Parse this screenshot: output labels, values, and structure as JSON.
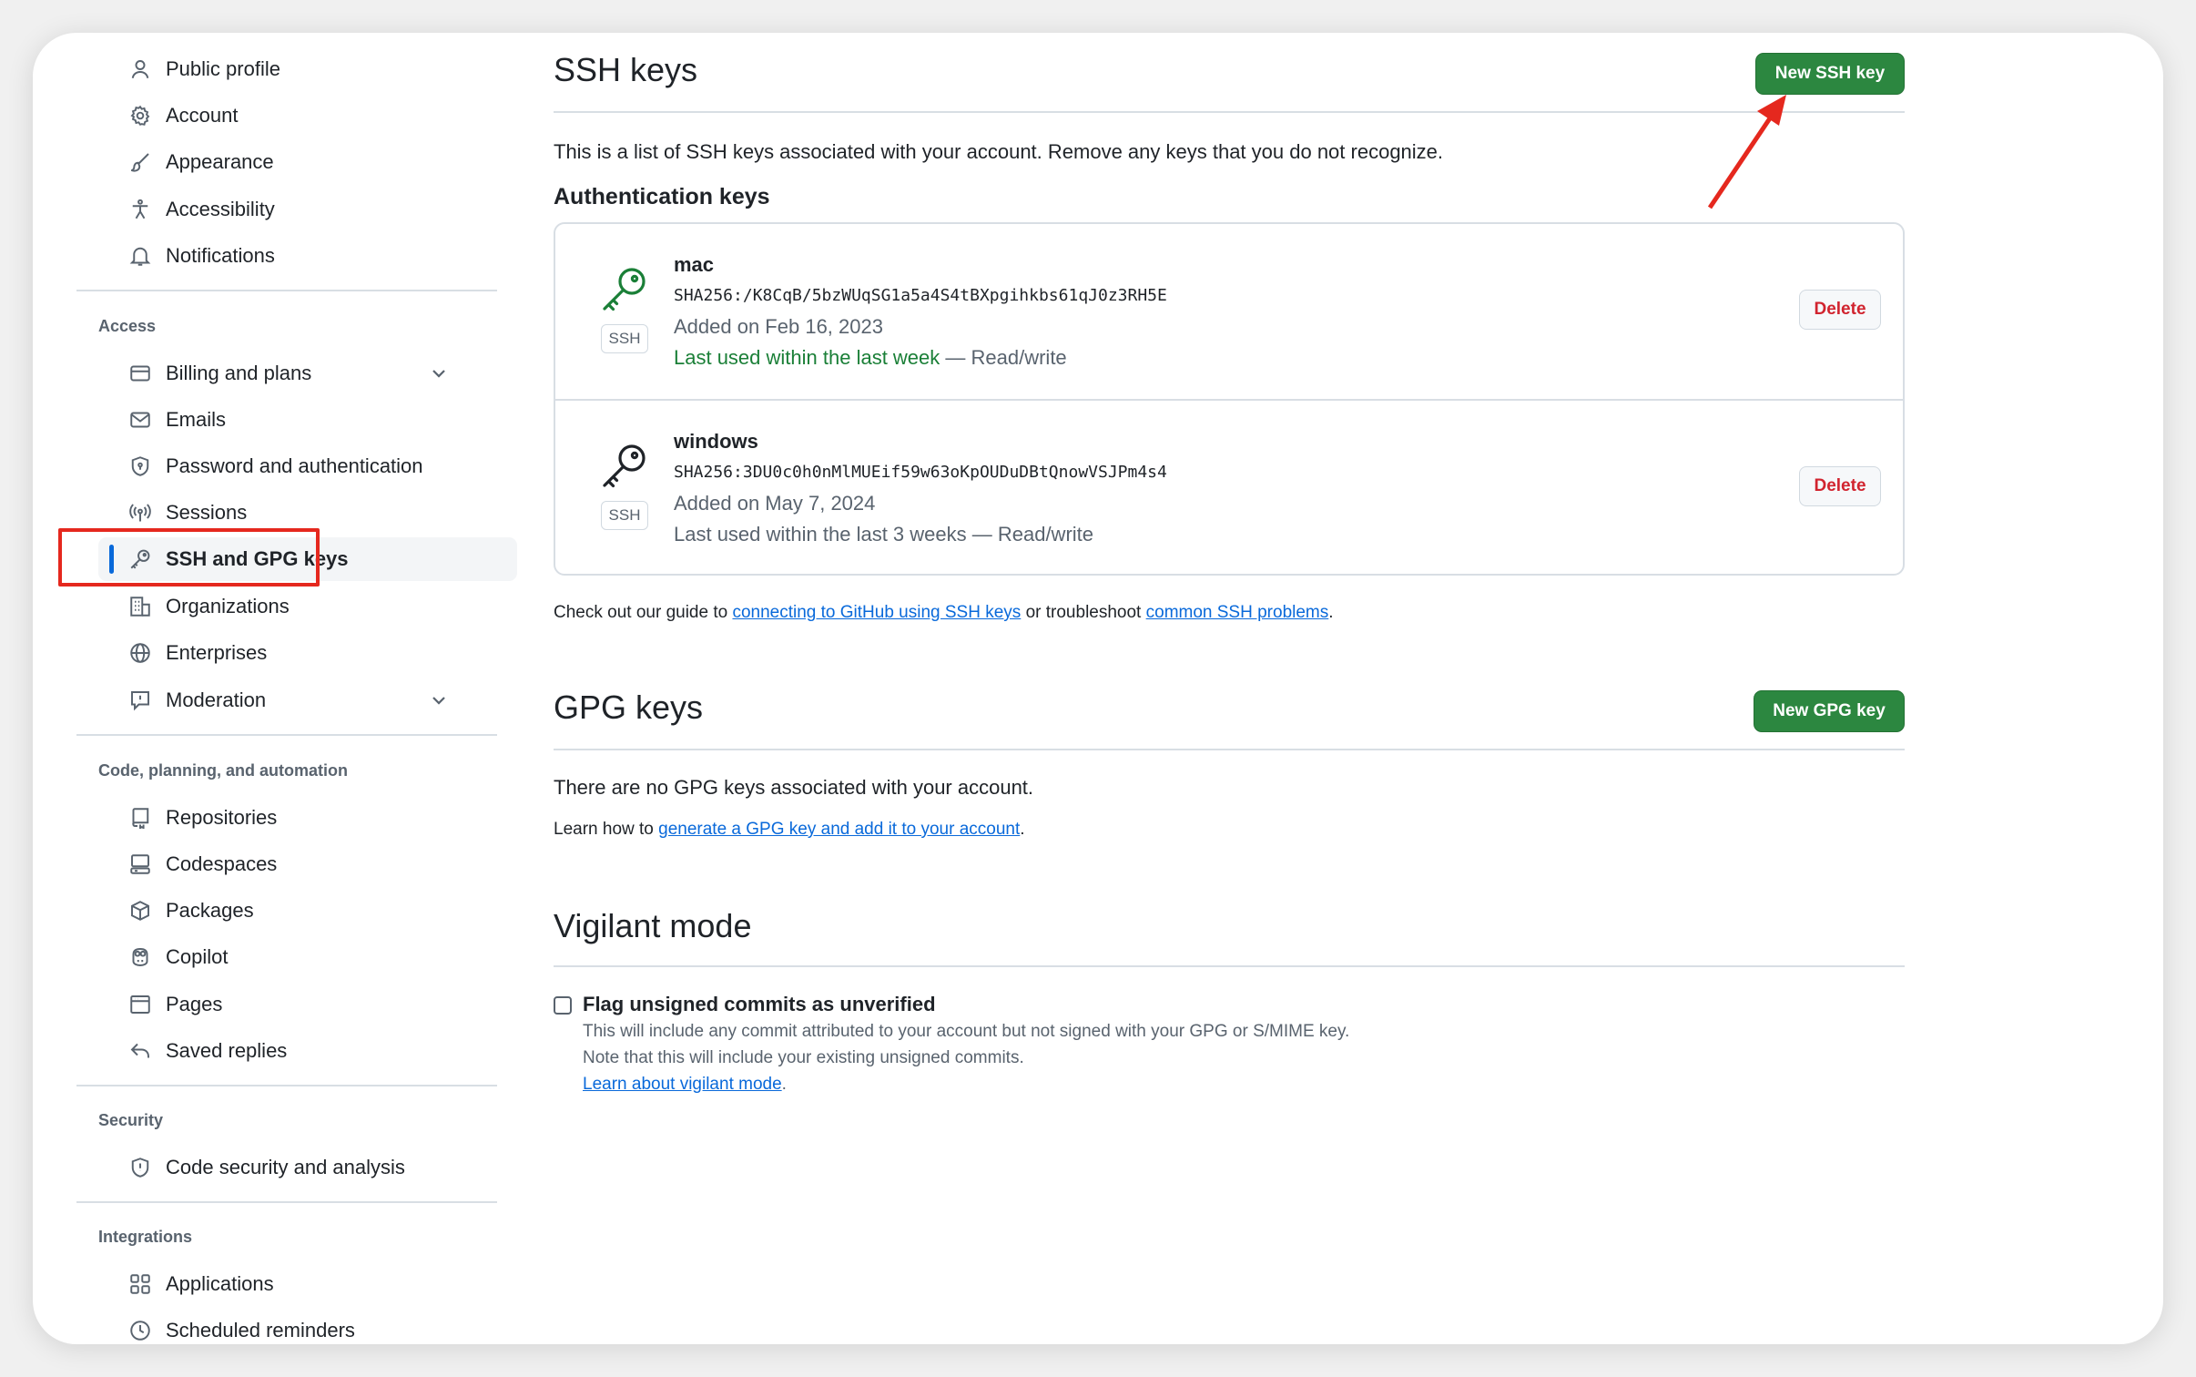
{
  "sidebar": {
    "top_items": [
      {
        "label": "Public profile",
        "icon": "person-icon"
      },
      {
        "label": "Account",
        "icon": "gear-icon"
      },
      {
        "label": "Appearance",
        "icon": "paintbrush-icon"
      },
      {
        "label": "Accessibility",
        "icon": "accessibility-icon"
      },
      {
        "label": "Notifications",
        "icon": "bell-icon"
      }
    ],
    "access": {
      "heading": "Access",
      "items": [
        {
          "label": "Billing and plans",
          "icon": "credit-card-icon"
        },
        {
          "label": "Emails",
          "icon": "mail-icon"
        },
        {
          "label": "Password and authentication",
          "icon": "shield-lock-icon"
        },
        {
          "label": "Sessions",
          "icon": "broadcast-icon"
        },
        {
          "label": "SSH and GPG keys",
          "icon": "key-icon"
        },
        {
          "label": "Organizations",
          "icon": "organization-icon"
        },
        {
          "label": "Enterprises",
          "icon": "globe-icon"
        },
        {
          "label": "Moderation",
          "icon": "report-icon"
        }
      ]
    },
    "code": {
      "heading": "Code, planning, and automation",
      "items": [
        {
          "label": "Repositories",
          "icon": "repo-icon"
        },
        {
          "label": "Codespaces",
          "icon": "codespaces-icon"
        },
        {
          "label": "Packages",
          "icon": "package-icon"
        },
        {
          "label": "Copilot",
          "icon": "copilot-icon"
        },
        {
          "label": "Pages",
          "icon": "browser-icon"
        },
        {
          "label": "Saved replies",
          "icon": "reply-icon"
        }
      ]
    },
    "security": {
      "heading": "Security",
      "items": [
        {
          "label": "Code security and analysis",
          "icon": "shield-icon"
        }
      ]
    },
    "integrations": {
      "heading": "Integrations",
      "items": [
        {
          "label": "Applications",
          "icon": "apps-icon"
        },
        {
          "label": "Scheduled reminders",
          "icon": "clock-icon"
        }
      ]
    }
  },
  "ssh": {
    "title": "SSH keys",
    "new_button": "New SSH key",
    "description": "This is a list of SSH keys associated with your account. Remove any keys that you do not recognize.",
    "auth_heading": "Authentication keys",
    "keys": [
      {
        "name": "mac",
        "fingerprint": "SHA256:/K8CqB/5bzWUqSG1a5a4S4tBXpgihkbs61qJ0z3RH5E",
        "added": "Added on Feb 16, 2023",
        "last_used": "Last used within the last week",
        "access": " — Read/write",
        "badge": "SSH",
        "delete_label": "Delete",
        "recent": true
      },
      {
        "name": "windows",
        "fingerprint": "SHA256:3DU0c0h0nMlMUEif59w63oKpOUDuDBtQnowVSJPm4s4",
        "added": "Added on May 7, 2024",
        "last_used": "Last used within the last 3 weeks",
        "access": " — Read/write",
        "badge": "SSH",
        "delete_label": "Delete",
        "recent": false
      }
    ],
    "guide_prefix": "Check out our guide to ",
    "guide_link1": "connecting to GitHub using SSH keys",
    "guide_mid": " or troubleshoot ",
    "guide_link2": "common SSH problems",
    "guide_suffix": "."
  },
  "gpg": {
    "title": "GPG keys",
    "new_button": "New GPG key",
    "empty_text": "There are no GPG keys associated with your account.",
    "learn_prefix": "Learn how to ",
    "learn_link": "generate a GPG key and add it to your account",
    "learn_suffix": "."
  },
  "vigilant": {
    "title": "Vigilant mode",
    "checkbox_label": "Flag unsigned commits as unverified",
    "checked": false,
    "note1": "This will include any commit attributed to your account but not signed with your GPG or S/MIME key.",
    "note2": "Note that this will include your existing unsigned commits.",
    "learn_link": "Learn about vigilant mode",
    "learn_suffix": "."
  },
  "colors": {
    "accent": "#0969da",
    "primary_button": "#2c8740",
    "danger": "#d1242f",
    "success_text": "#1a7f37",
    "annotation": "#e5281e"
  }
}
